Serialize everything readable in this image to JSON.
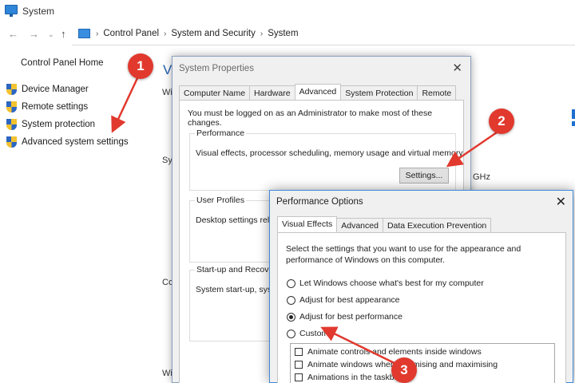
{
  "window": {
    "title": "System",
    "breadcrumbs": [
      "Control Panel",
      "System and Security",
      "System"
    ]
  },
  "left_nav": {
    "home": "Control Panel Home",
    "items": [
      {
        "label": "Device Manager",
        "icon": "shield-icon"
      },
      {
        "label": "Remote settings",
        "icon": "shield-icon"
      },
      {
        "label": "System protection",
        "icon": "shield-icon"
      },
      {
        "label": "Advanced system settings",
        "icon": "shield-icon"
      }
    ]
  },
  "background": {
    "heading": "Vi",
    "frag_wi": "Wi",
    "frag_sys": "Sy",
    "frag_co": "Co",
    "frag_wi2": "Wi",
    "frag_ghz": "GHz"
  },
  "system_properties": {
    "title": "System Properties",
    "tabs": [
      "Computer Name",
      "Hardware",
      "Advanced",
      "System Protection",
      "Remote"
    ],
    "active_tab": "Advanced",
    "admin_note": "You must be logged on as an Administrator to make most of these changes.",
    "performance": {
      "label": "Performance",
      "description": "Visual effects, processor scheduling, memory usage and virtual memory",
      "settings_button": "Settings..."
    },
    "user_profiles": {
      "label": "User Profiles",
      "description": "Desktop settings relat"
    },
    "startup": {
      "label": "Start-up and Recovery",
      "description": "System start-up, syster"
    }
  },
  "performance_options": {
    "title": "Performance Options",
    "tabs": [
      "Visual Effects",
      "Advanced",
      "Data Execution Prevention"
    ],
    "active_tab": "Visual Effects",
    "intro": "Select the settings that you want to use for the appearance and performance of Windows on this computer.",
    "radios": [
      {
        "label": "Let Windows choose what's best for my computer",
        "selected": false
      },
      {
        "label": "Adjust for best appearance",
        "selected": false
      },
      {
        "label": "Adjust for best performance",
        "selected": true
      },
      {
        "label": "Custom:",
        "selected": false
      }
    ],
    "checkboxes": [
      {
        "label": "Animate controls and elements inside windows",
        "checked": false
      },
      {
        "label": "Animate windows when minimising and maximising",
        "checked": false
      },
      {
        "label": "Animations in the taskbar",
        "checked": false
      }
    ]
  },
  "annotations": {
    "step1": "1",
    "step2": "2",
    "step3": "3",
    "color": "#e1392e"
  }
}
